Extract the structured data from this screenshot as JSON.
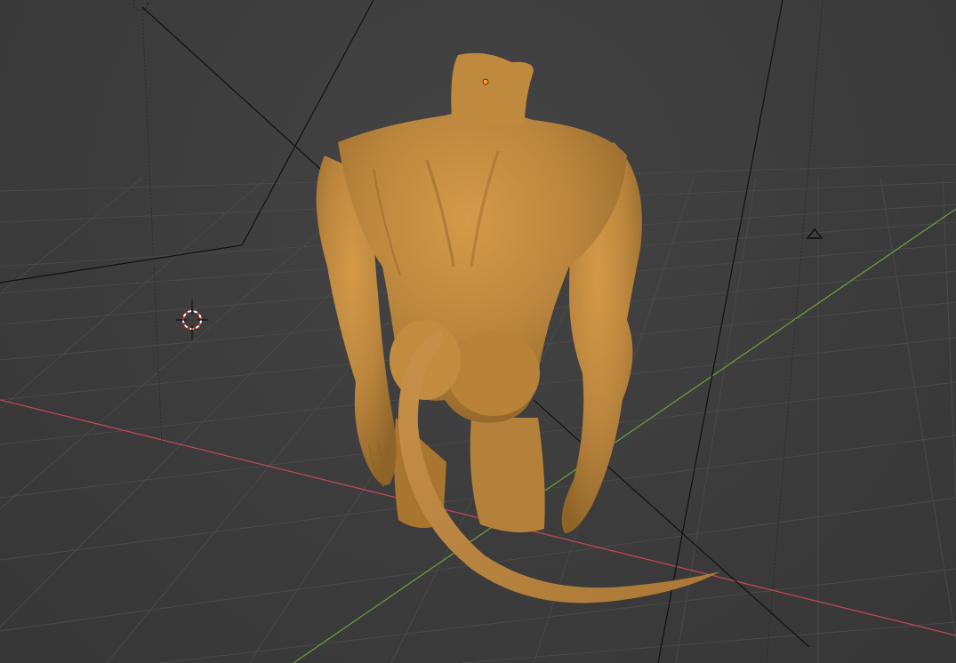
{
  "app": "3D Viewport",
  "view": {
    "mode": "solid",
    "object_color": "#c08a3e",
    "grid_color": "#4a4a4a",
    "x_axis_color": "#b84a57",
    "y_axis_color": "#6a9a3a",
    "background_color": "#3d3d3d"
  },
  "scene_objects": [
    {
      "id": "sculpt",
      "name": "creature-sculpt-mesh",
      "type": "mesh"
    },
    {
      "id": "camera",
      "name": "scene-camera",
      "type": "camera"
    },
    {
      "id": "light",
      "name": "scene-light",
      "type": "light"
    },
    {
      "id": "cursor",
      "name": "3d-cursor",
      "type": "cursor"
    }
  ],
  "icons": {
    "cursor": "3d-cursor-icon",
    "light": "sun-light-icon",
    "origin": "object-origin-icon"
  }
}
